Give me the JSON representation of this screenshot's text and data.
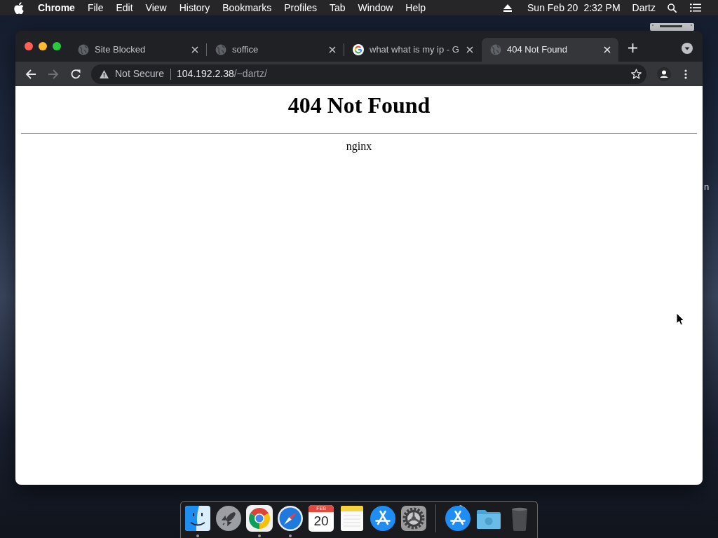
{
  "menu_bar": {
    "app_name": "Chrome",
    "menus": [
      "File",
      "Edit",
      "View",
      "History",
      "Bookmarks",
      "Profiles",
      "Tab",
      "Window",
      "Help"
    ],
    "date": "Sun Feb 20",
    "time": "2:32 PM",
    "user": "Dartz"
  },
  "desktop": {
    "icon_label": "n"
  },
  "browser": {
    "tabs": [
      {
        "title": "Site Blocked",
        "kind": "globe",
        "selected": false
      },
      {
        "title": "soffice",
        "kind": "globe",
        "selected": false
      },
      {
        "title": "what what is my ip - G",
        "kind": "google",
        "selected": false
      },
      {
        "title": "404 Not Found",
        "kind": "globe",
        "selected": true
      }
    ],
    "toolbar": {
      "back": {
        "disabled": false
      },
      "forward": {
        "disabled": true
      }
    },
    "address_bar": {
      "security_label": "Not Secure",
      "host": "104.192.2.38",
      "path": "/~dartz/"
    }
  },
  "page": {
    "heading": "404 Not Found",
    "server": "nginx"
  },
  "dock": {
    "apps": [
      {
        "kind": "finder",
        "running": true
      },
      {
        "kind": "launchpad",
        "running": false
      },
      {
        "kind": "chrome",
        "running": true
      },
      {
        "kind": "safari",
        "running": true
      },
      {
        "kind": "calendar",
        "running": false,
        "month": "FEB",
        "day": "20"
      },
      {
        "kind": "notes",
        "running": false
      },
      {
        "kind": "app-store",
        "running": false
      },
      {
        "kind": "system-preferences",
        "running": false
      }
    ],
    "stacks": [
      {
        "kind": "app-store"
      },
      {
        "kind": "folder"
      },
      {
        "kind": "trash"
      }
    ]
  }
}
